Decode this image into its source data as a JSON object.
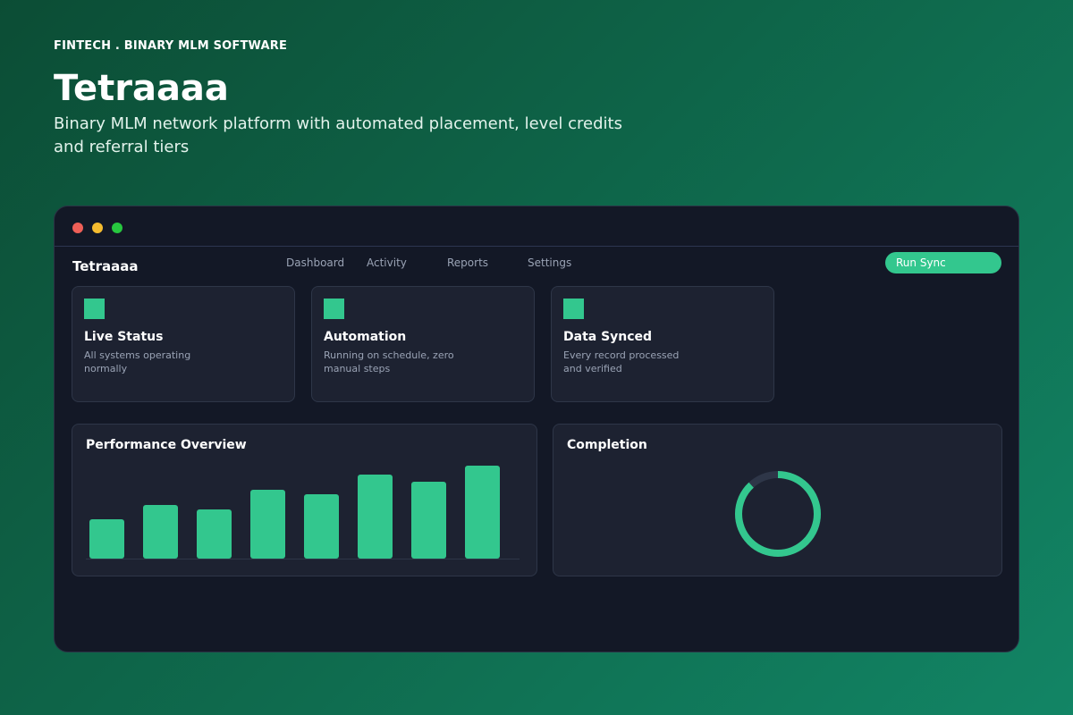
{
  "hero": {
    "eyebrow": "FINTECH . BINARY MLM SOFTWARE",
    "title": "Tetraaaa",
    "subtitle": "Binary MLM network platform with automated placement, level credits and referral tiers"
  },
  "app": {
    "brand": "Tetraaaa",
    "nav": [
      "Dashboard",
      "Activity",
      "Reports",
      "Settings"
    ],
    "action_button": "Run Sync"
  },
  "cards": [
    {
      "title": "Live Status",
      "description": "All systems operating normally"
    },
    {
      "title": "Automation",
      "description": "Running on schedule, zero manual steps"
    },
    {
      "title": "Data Synced",
      "description": "Every record processed and verified"
    }
  ],
  "panels": {
    "performance_title": "Performance Overview",
    "completion_title": "Completion"
  },
  "colors": {
    "accent": "#33c78e",
    "track": "#2e3648",
    "window_bg": "#131826",
    "card_bg": "#1d2231"
  },
  "chart_data": [
    {
      "type": "bar",
      "title": "Performance Overview",
      "values": [
        44,
        60,
        55,
        77,
        72,
        94,
        86,
        104
      ],
      "ylim": [
        0,
        110
      ],
      "grid": false,
      "color": "#33c78e"
    },
    {
      "type": "pie",
      "title": "Completion",
      "values": [
        0.88
      ],
      "color": "#33c78e",
      "track_color": "#2e3648"
    }
  ]
}
